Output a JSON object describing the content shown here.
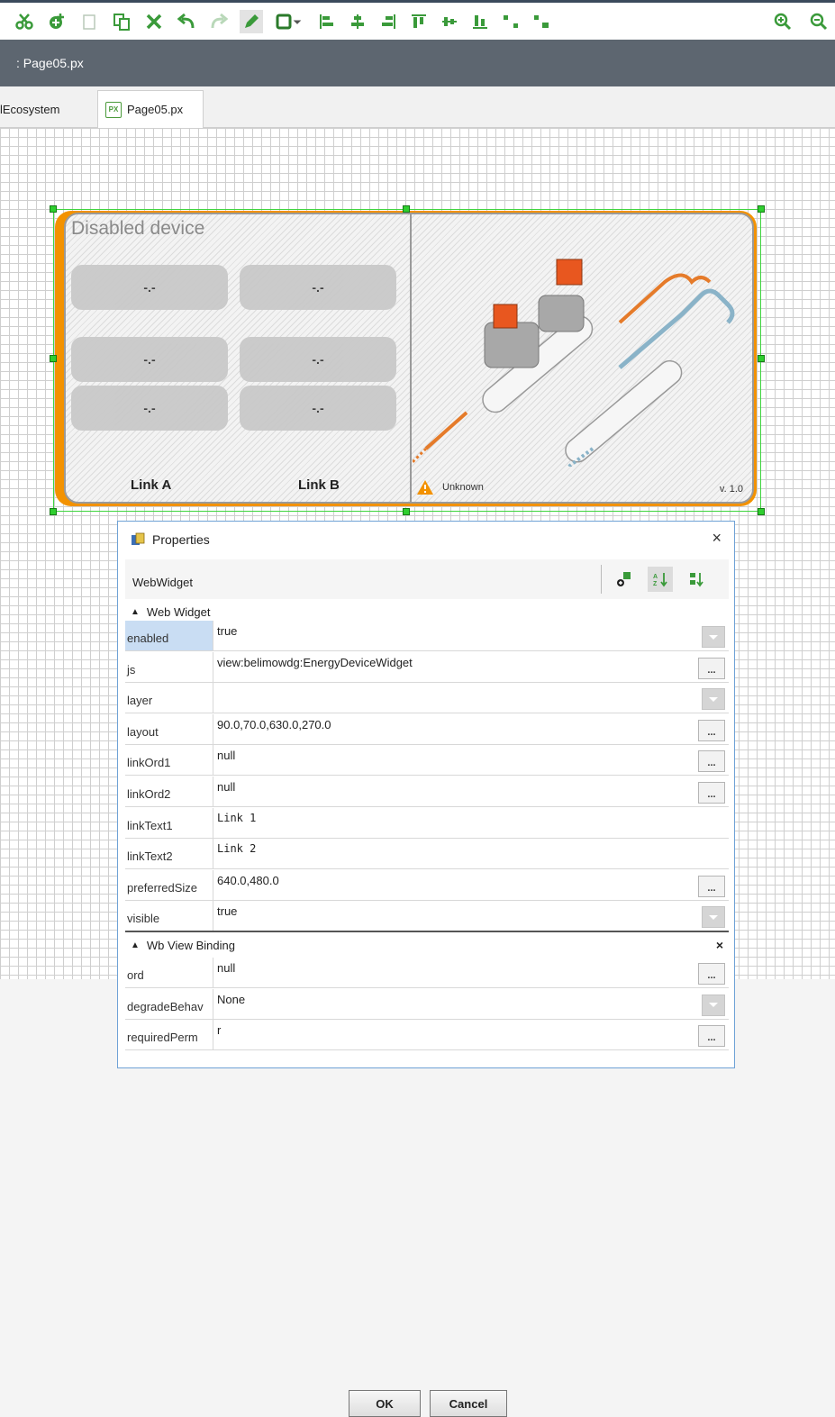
{
  "toolbar": {
    "icons": [
      "cut-icon",
      "add-icon",
      "clipboard-icon",
      "paste-icon",
      "delete-icon",
      "undo-icon",
      "redo-icon",
      "pencil-icon",
      "rectangle-icon",
      "dropdown-icon",
      "align-left-icon",
      "align-center-icon",
      "align-right-icon",
      "align-top-icon",
      "align-middle-icon",
      "align-bottom-icon",
      "distribute-horizontal-icon",
      "distribute-vertical-icon",
      "zoom-in-icon",
      "zoom-out-icon"
    ]
  },
  "pathbar": {
    "text": ": Page05.px"
  },
  "tabs": [
    {
      "label": "lEcosystem"
    },
    {
      "label": "Page05.px",
      "icon_text": "PX"
    }
  ],
  "widget": {
    "title": "Disabled device",
    "tiles": [
      "-.-",
      "-.-",
      "-.-",
      "-.-",
      "-.-",
      "-.-"
    ],
    "link_a": "Link A",
    "link_b": "Link B",
    "status": "Unknown",
    "version": "v. 1.0",
    "accent_color": "#f39200"
  },
  "dialog": {
    "title": "Properties",
    "close": "×",
    "subheader": "WebWidget",
    "section1": "Web Widget",
    "section2": "Wb View Binding",
    "section2_close": "×",
    "properties": [
      {
        "name": "enabled",
        "value": "true",
        "control": "dropdown"
      },
      {
        "name": "js",
        "value": "view:belimowdg:EnergyDeviceWidget",
        "control": "ellipsis"
      },
      {
        "name": "layer",
        "value": "",
        "control": "dropdown"
      },
      {
        "name": "layout",
        "value": "90.0,70.0,630.0,270.0",
        "control": "ellipsis"
      },
      {
        "name": "linkOrd1",
        "value": "null",
        "control": "ellipsis"
      },
      {
        "name": "linkOrd2",
        "value": "null",
        "control": "ellipsis"
      },
      {
        "name": "linkText1",
        "value": "Link 1",
        "control": "none"
      },
      {
        "name": "linkText2",
        "value": "Link 2",
        "control": "none"
      },
      {
        "name": "preferredSize",
        "value": "640.0,480.0",
        "control": "ellipsis"
      },
      {
        "name": "visible",
        "value": "true",
        "control": "dropdown"
      }
    ],
    "binding_properties": [
      {
        "name": "ord",
        "value": "null",
        "control": "ellipsis"
      },
      {
        "name": "degradeBehav",
        "value": "None",
        "control": "dropdown"
      },
      {
        "name": "requiredPerm",
        "value": "r",
        "control": "ellipsis"
      }
    ],
    "ellipsis": "...",
    "ok_label": "OK",
    "cancel_label": "Cancel"
  }
}
